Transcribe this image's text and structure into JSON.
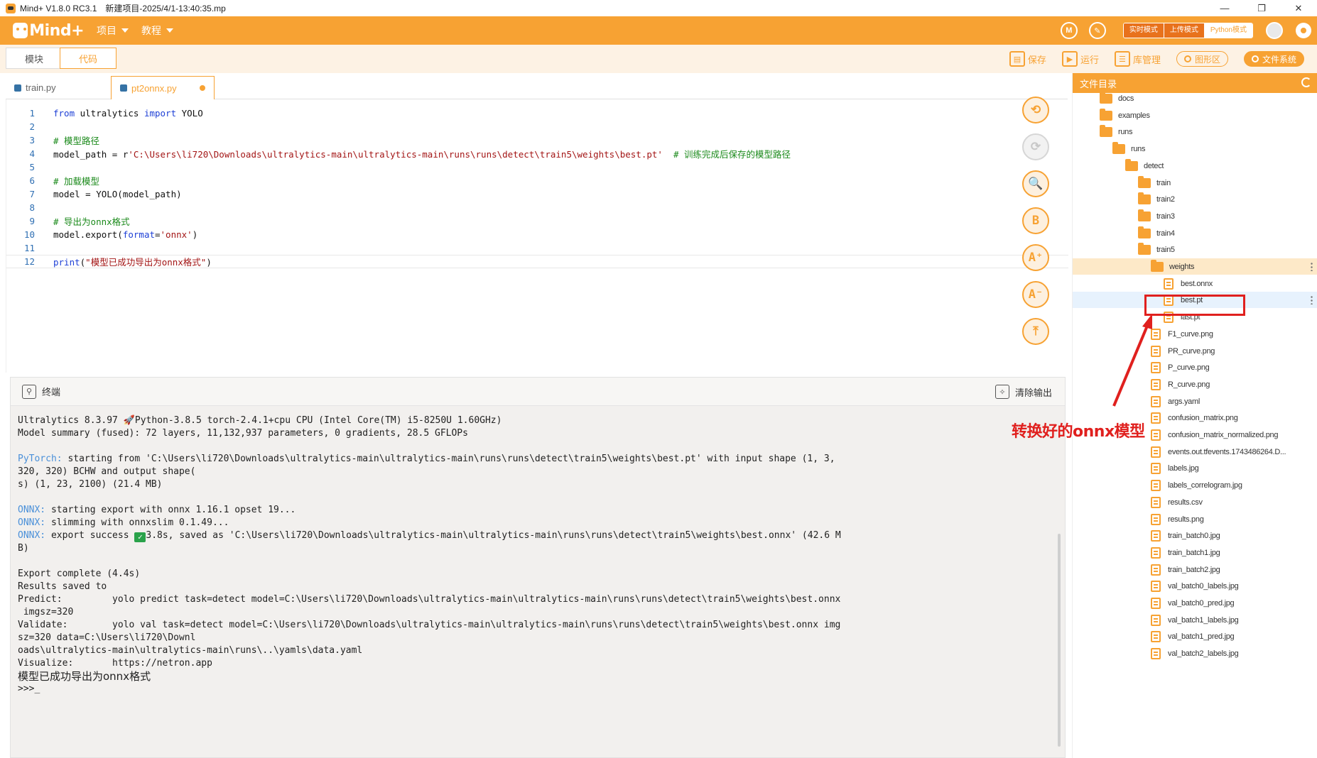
{
  "window": {
    "title": "Mind+ V1.8.0 RC3.1",
    "project": "新建项目-2025/4/1-13:40:35.mp",
    "min_glyph": "—",
    "max_glyph": "❐",
    "close_glyph": "✕"
  },
  "menubar": {
    "logo": "Mind+",
    "items": [
      {
        "label": "项目"
      },
      {
        "label": "教程"
      }
    ],
    "modes": [
      {
        "label": "实时模式"
      },
      {
        "label": "上传模式"
      },
      {
        "label": "Python模式"
      }
    ],
    "accent": "#f7a233"
  },
  "toolbar": {
    "tabs": [
      {
        "label": "模块"
      },
      {
        "label": "代码"
      }
    ],
    "save": "保存",
    "run": "运行",
    "library": "库管理",
    "graphics": "图形区",
    "filesystem": "文件系统"
  },
  "filetabs": [
    {
      "label": "train.py"
    },
    {
      "label": "pt2onnx.py"
    }
  ],
  "editor": {
    "lines": [
      {
        "n": "1",
        "segments": [
          {
            "t": "from",
            "c": "kw"
          },
          {
            "t": " ultralytics ",
            "c": ""
          },
          {
            "t": "import",
            "c": "kw"
          },
          {
            "t": " YOLO",
            "c": ""
          }
        ]
      },
      {
        "n": "2",
        "segments": []
      },
      {
        "n": "3",
        "segments": [
          {
            "t": "# 模型路径",
            "c": "cm"
          }
        ]
      },
      {
        "n": "4",
        "segments": [
          {
            "t": "model_path = r",
            "c": ""
          },
          {
            "t": "'C:\\Users\\li720\\Downloads\\ultralytics-main\\ultralytics-main\\runs\\runs\\detect\\train5\\weights\\best.pt'",
            "c": "st"
          },
          {
            "t": "  # 训练完成后保存的模型路径",
            "c": "cm"
          }
        ]
      },
      {
        "n": "5",
        "segments": []
      },
      {
        "n": "6",
        "segments": [
          {
            "t": "# 加载模型",
            "c": "cm"
          }
        ]
      },
      {
        "n": "7",
        "segments": [
          {
            "t": "model = YOLO(model_path)",
            "c": ""
          }
        ]
      },
      {
        "n": "8",
        "segments": []
      },
      {
        "n": "9",
        "segments": [
          {
            "t": "# 导出为onnx格式",
            "c": "cm"
          }
        ]
      },
      {
        "n": "10",
        "segments": [
          {
            "t": "model.export(",
            "c": ""
          },
          {
            "t": "format",
            "c": "kw"
          },
          {
            "t": "=",
            "c": ""
          },
          {
            "t": "'onnx'",
            "c": "st"
          },
          {
            "t": ")",
            "c": ""
          }
        ]
      },
      {
        "n": "11",
        "segments": []
      },
      {
        "n": "12",
        "segments": [
          {
            "t": "print",
            "c": "kw"
          },
          {
            "t": "(",
            "c": ""
          },
          {
            "t": "\"模型已成功导出为onnx格式\"",
            "c": "st"
          },
          {
            "t": ")",
            "c": ""
          }
        ]
      }
    ],
    "side_tools": [
      {
        "name": "undo-icon",
        "glyph": "⟲"
      },
      {
        "name": "redo-icon",
        "glyph": "⟳"
      },
      {
        "name": "search-icon",
        "glyph": "🔍"
      },
      {
        "name": "format-icon",
        "glyph": "B"
      },
      {
        "name": "font-increase-icon",
        "glyph": "A⁺"
      },
      {
        "name": "font-decrease-icon",
        "glyph": "A⁻"
      },
      {
        "name": "scroll-top-icon",
        "glyph": "⤒"
      }
    ]
  },
  "terminal": {
    "title": "终端",
    "clear_label": "清除输出",
    "lines": [
      [
        {
          "t": "Ultralytics 8.3.97 🚀Python-3.8.5 torch-2.4.1+cpu CPU (Intel Core(TM) i5-8250U 1.60GHz)",
          "c": ""
        }
      ],
      [
        {
          "t": "Model summary (fused): 72 layers, 11,132,937 parameters, 0 gradients, 28.5 GFLOPs",
          "c": ""
        }
      ],
      [],
      [
        {
          "t": "PyTorch:",
          "c": "tag"
        },
        {
          "t": " starting from 'C:\\Users\\li720\\Downloads\\ultralytics-main\\ultralytics-main\\runs\\runs\\detect\\train5\\weights\\best.pt' with input shape (1, 3,",
          "c": ""
        }
      ],
      [
        {
          "t": "320, 320) BCHW and output shape(",
          "c": ""
        }
      ],
      [
        {
          "t": "s) (1, 23, 2100) (21.4 MB)",
          "c": ""
        }
      ],
      [],
      [
        {
          "t": "ONNX:",
          "c": "tag"
        },
        {
          "t": " starting export with onnx 1.16.1 opset 19...",
          "c": ""
        }
      ],
      [
        {
          "t": "ONNX:",
          "c": "tag"
        },
        {
          "t": " slimming with onnxslim 0.1.49...",
          "c": ""
        }
      ],
      [
        {
          "t": "ONNX:",
          "c": "tag"
        },
        {
          "t": " export success ",
          "c": ""
        },
        {
          "t": "✓",
          "c": "check"
        },
        {
          "t": "3.8s, saved as 'C:\\Users\\li720\\Downloads\\ultralytics-main\\ultralytics-main\\runs\\runs\\detect\\train5\\weights\\best.onnx' (42.6 M",
          "c": ""
        }
      ],
      [
        {
          "t": "B)",
          "c": ""
        }
      ],
      [],
      [
        {
          "t": "Export complete (4.4s)",
          "c": ""
        }
      ],
      [
        {
          "t": "Results saved to",
          "c": ""
        }
      ],
      [
        {
          "t": "Predict:         yolo predict task=detect model=C:\\Users\\li720\\Downloads\\ultralytics-main\\ultralytics-main\\runs\\runs\\detect\\train5\\weights\\best.onnx",
          "c": ""
        }
      ],
      [
        {
          "t": " imgsz=320",
          "c": ""
        }
      ],
      [
        {
          "t": "Validate:        yolo val task=detect model=C:\\Users\\li720\\Downloads\\ultralytics-main\\ultralytics-main\\runs\\runs\\detect\\train5\\weights\\best.onnx img",
          "c": ""
        }
      ],
      [
        {
          "t": "sz=320 data=C:\\Users\\li720\\Downl",
          "c": ""
        }
      ],
      [
        {
          "t": "oads\\ultralytics-main\\ultralytics-main\\runs\\..\\yamls\\data.yaml",
          "c": ""
        }
      ],
      [
        {
          "t": "Visualize:       https://netron.app",
          "c": ""
        }
      ],
      [
        {
          "t": "模型已成功导出为onnx格式",
          "c": "cjk-big"
        }
      ],
      [
        {
          "t": ">>>_",
          "c": ""
        }
      ]
    ]
  },
  "filepanel": {
    "title": "文件目录",
    "items": [
      {
        "label": "docs",
        "type": "folder",
        "depth": 2
      },
      {
        "label": "examples",
        "type": "folder",
        "depth": 2
      },
      {
        "label": "runs",
        "type": "folder",
        "depth": 2,
        "open": true
      },
      {
        "label": "runs",
        "type": "folder",
        "depth": 3,
        "open": true
      },
      {
        "label": "detect",
        "type": "folder",
        "depth": 4,
        "open": true
      },
      {
        "label": "train",
        "type": "folder",
        "depth": 5
      },
      {
        "label": "train2",
        "type": "folder",
        "depth": 5
      },
      {
        "label": "train3",
        "type": "folder",
        "depth": 5
      },
      {
        "label": "train4",
        "type": "folder",
        "depth": 5
      },
      {
        "label": "train5",
        "type": "folder",
        "depth": 5,
        "open": true
      },
      {
        "label": "weights",
        "type": "folder",
        "depth": 6,
        "open": true,
        "sel": "folder"
      },
      {
        "label": "best.onnx",
        "type": "file",
        "depth": 7
      },
      {
        "label": "best.pt",
        "type": "file",
        "depth": 7,
        "sel": "file"
      },
      {
        "label": "last.pt",
        "type": "file",
        "depth": 7
      },
      {
        "label": "F1_curve.png",
        "type": "file",
        "depth": 6
      },
      {
        "label": "PR_curve.png",
        "type": "file",
        "depth": 6
      },
      {
        "label": "P_curve.png",
        "type": "file",
        "depth": 6
      },
      {
        "label": "R_curve.png",
        "type": "file",
        "depth": 6
      },
      {
        "label": "args.yaml",
        "type": "file",
        "depth": 6
      },
      {
        "label": "confusion_matrix.png",
        "type": "file",
        "depth": 6
      },
      {
        "label": "confusion_matrix_normalized.png",
        "type": "file",
        "depth": 6
      },
      {
        "label": "events.out.tfevents.1743486264.D...",
        "type": "file",
        "depth": 6
      },
      {
        "label": "labels.jpg",
        "type": "file",
        "depth": 6
      },
      {
        "label": "labels_correlogram.jpg",
        "type": "file",
        "depth": 6
      },
      {
        "label": "results.csv",
        "type": "file",
        "depth": 6
      },
      {
        "label": "results.png",
        "type": "file",
        "depth": 6
      },
      {
        "label": "train_batch0.jpg",
        "type": "file",
        "depth": 6
      },
      {
        "label": "train_batch1.jpg",
        "type": "file",
        "depth": 6
      },
      {
        "label": "train_batch2.jpg",
        "type": "file",
        "depth": 6
      },
      {
        "label": "val_batch0_labels.jpg",
        "type": "file",
        "depth": 6
      },
      {
        "label": "val_batch0_pred.jpg",
        "type": "file",
        "depth": 6
      },
      {
        "label": "val_batch1_labels.jpg",
        "type": "file",
        "depth": 6
      },
      {
        "label": "val_batch1_pred.jpg",
        "type": "file",
        "depth": 6
      },
      {
        "label": "val_batch2_labels.jpg",
        "type": "file",
        "depth": 6
      }
    ]
  },
  "annotation": {
    "text": "转换好的onnx模型",
    "color": "#e0201e"
  }
}
